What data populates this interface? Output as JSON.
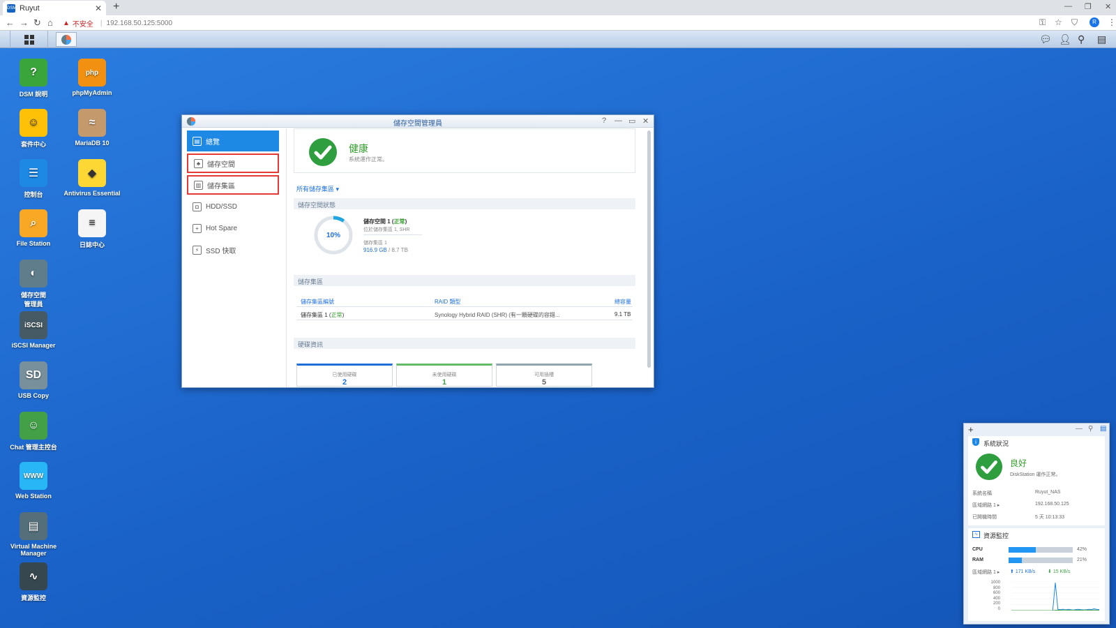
{
  "browser": {
    "tab_title": "Ruyut",
    "tab_favicon": "DSM",
    "new_tab": "+",
    "insecure_label": "不安全",
    "url": "192.168.50.125:5000",
    "profile_initial": "R"
  },
  "desktop_icons": [
    {
      "id": "dsm-help",
      "label": "DSM 說明",
      "glyph": "?",
      "color": "#3aa53a"
    },
    {
      "id": "phpmyadmin",
      "label": "phpMyAdmin",
      "glyph": "php",
      "color": "#f29111"
    },
    {
      "id": "package-center",
      "label": "套件中心",
      "glyph": "☺",
      "color": "#ffc107"
    },
    {
      "id": "mariadb",
      "label": "MariaDB 10",
      "glyph": "≈",
      "color": "#c49a6c"
    },
    {
      "id": "control-panel",
      "label": "控制台",
      "glyph": "☰",
      "color": "#1e88e5"
    },
    {
      "id": "antivirus",
      "label": "Antivirus Essential",
      "glyph": "◆",
      "color": "#fdd835"
    },
    {
      "id": "file-station",
      "label": "File Station",
      "glyph": "⌕",
      "color": "#f9a825"
    },
    {
      "id": "log-center",
      "label": "日誌中心",
      "glyph": "≡",
      "color": "#f5f5f5"
    },
    {
      "id": "storage-manager",
      "label1": "儲存空間",
      "label2": "管理員",
      "glyph": "◐",
      "color": "#607d8b"
    },
    {
      "id": "iscsi",
      "label": "iSCSI Manager",
      "glyph": "iSCSI",
      "color": "#455a64"
    },
    {
      "id": "usb-copy",
      "label": "USB Copy",
      "glyph": "SD",
      "color": "#78909c"
    },
    {
      "id": "chat",
      "label": "Chat 管理主控台",
      "glyph": "☺",
      "color": "#43a047"
    },
    {
      "id": "web-station",
      "label": "Web Station",
      "glyph": "WWW",
      "color": "#29b6f6"
    },
    {
      "id": "vmm",
      "label1": "Virtual Machine",
      "label2": "Manager",
      "glyph": "▤",
      "color": "#546e7a"
    },
    {
      "id": "resource-monitor",
      "label": "資源監控",
      "glyph": "∿",
      "color": "#37474f"
    }
  ],
  "window": {
    "title": "儲存空間管理員",
    "sidebar": [
      {
        "label": "總覽",
        "glyph": "▤"
      },
      {
        "label": "儲存空間",
        "glyph": "♣"
      },
      {
        "label": "儲存集區",
        "glyph": "▥"
      },
      {
        "label": "HDD/SSD",
        "glyph": "◘"
      },
      {
        "label": "Hot Spare",
        "glyph": "+"
      },
      {
        "label": "SSD 快取",
        "glyph": "⚡"
      }
    ],
    "health": {
      "status": "健康",
      "sub": "系統運作正常。"
    },
    "pool_filter": "所有儲存集區",
    "volume_section": "儲存空間狀態",
    "volume": {
      "percent": 10,
      "percent_label": "10%",
      "name": "儲存空間 1",
      "status": "正常",
      "location": "位於儲存集區 1, SHR",
      "pool_label": "儲存集區 1",
      "used": "916.9 GB",
      "total": "8.7 TB"
    },
    "pool_section": "儲存集區",
    "pool_table": {
      "headers": [
        "儲存集區編號",
        "RAID 類型",
        "總容量"
      ],
      "rows": [
        [
          "儲存集區 1",
          "正常",
          "Synology Hybrid RAID (SHR) (有一顆硬碟的容錯...",
          "9.1 TB"
        ]
      ]
    },
    "disk_section": "硬碟資訊",
    "disks": [
      {
        "label": "已使用硬碟",
        "value": "2",
        "color": "#1e6fd9"
      },
      {
        "label": "未使用硬碟",
        "value": "1",
        "color": "#66bb6a"
      },
      {
        "label": "可用插槽",
        "value": "5",
        "color": "#90a4ae"
      }
    ]
  },
  "widget": {
    "add": "+",
    "system_title": "系統狀況",
    "status": "良好",
    "status_sub": "DiskStation 運作正常。",
    "rows": [
      {
        "label": "系統名稱",
        "value": "Ruyut_NAS"
      },
      {
        "label": "區域網路 1",
        "value": "192.168.50.125"
      },
      {
        "label": "已開機時間",
        "value": "5 天 10:13:33"
      }
    ],
    "resource_title": "資源監控",
    "cpu": {
      "label": "CPU",
      "percent": 42,
      "text": "42%"
    },
    "ram": {
      "label": "RAM",
      "percent": 21,
      "text": "21%"
    },
    "net_label": "區域網路 1",
    "upload": "171 KB/s",
    "download": "15 KB/s",
    "y_ticks": [
      "1000",
      "800",
      "600",
      "400",
      "200",
      "0"
    ],
    "chart_data": {
      "type": "line",
      "y_ticks": [
        1000,
        800,
        600,
        400,
        200,
        0
      ],
      "ylim": [
        0,
        1000
      ],
      "series": [
        {
          "values": [
            0,
            0,
            0,
            0,
            0,
            0,
            0,
            0,
            0,
            0,
            0,
            0,
            0,
            0,
            0,
            0,
            0,
            950,
            40,
            30,
            45,
            25,
            40,
            30,
            20,
            35,
            40,
            30,
            25,
            30,
            40,
            35,
            60,
            40,
            30
          ]
        },
        {
          "values": [
            0,
            0,
            0,
            0,
            0,
            0,
            0,
            0,
            0,
            0,
            0,
            0,
            0,
            0,
            0,
            0,
            0,
            10,
            15,
            10,
            20,
            15,
            10,
            15,
            20,
            10,
            15,
            10,
            15,
            20,
            10,
            15,
            20,
            15,
            10
          ]
        }
      ]
    }
  }
}
